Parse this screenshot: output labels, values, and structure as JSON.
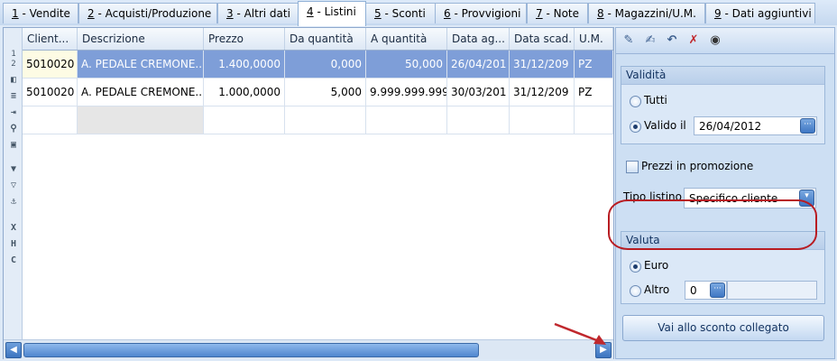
{
  "tabs": [
    {
      "key": "1",
      "label": " - Vendite"
    },
    {
      "key": "2",
      "label": " - Acquisti/Produzione"
    },
    {
      "key": "3",
      "label": " - Altri dati"
    },
    {
      "key": "4",
      "label": " - Listini"
    },
    {
      "key": "5",
      "label": " - Sconti"
    },
    {
      "key": "6",
      "label": " - Provvigioni"
    },
    {
      "key": "7",
      "label": " - Note"
    },
    {
      "key": "8",
      "label": " - Magazzini/U.M."
    },
    {
      "key": "9",
      "label": " - Dati aggiuntivi"
    }
  ],
  "active_tab": "4 - Listini",
  "grid": {
    "columns": [
      "Client...",
      "Descrizione",
      "Prezzo",
      "Da quantità",
      "A quantità",
      "Data ag...",
      "Data scad.",
      "U.M."
    ],
    "rows": [
      [
        "5010020",
        "A. PEDALE CREMONE...",
        "1.400,0000",
        "0,000",
        "50,000",
        "26/04/201",
        "31/12/209",
        "PZ"
      ],
      [
        "5010020",
        "A. PEDALE CREMONE...",
        "1.000,0000",
        "5,000",
        "9.999.999.999",
        "30/03/201",
        "31/12/209",
        "PZ"
      ]
    ],
    "row_numbers": [
      "1",
      "2"
    ]
  },
  "left_toolbar": [
    "record-icon",
    "list-icon",
    "insert-icon",
    "zoom-icon",
    "form-icon",
    "filter-icon",
    "filter-clear-icon",
    "anchor-icon",
    "export-x-icon",
    "export-h-icon",
    "export-c-icon"
  ],
  "left_toolbar_letters": {
    "x": "X",
    "h": "H",
    "c": "C"
  },
  "right_toolbar": [
    "edit-icon",
    "save-icon",
    "undo-icon",
    "delete-icon",
    "binoculars-icon"
  ],
  "validita": {
    "title": "Validità",
    "tutti": "Tutti",
    "valido_il": "Valido il",
    "date": "26/04/2012",
    "selected": "Valido il"
  },
  "prezzi_promozione": "Prezzi in promozione",
  "tipo_listino": {
    "label": "Tipo listino",
    "value": "Specifico cliente"
  },
  "valuta": {
    "title": "Valuta",
    "euro": "Euro",
    "altro": "Altro",
    "altro_value": "0",
    "selected": "Euro"
  },
  "button_sconto": "Vai allo sconto collegato",
  "colors": {
    "selection": "#7e9ed8",
    "highlight": "#b81c22",
    "arrow": "#c0282d"
  }
}
